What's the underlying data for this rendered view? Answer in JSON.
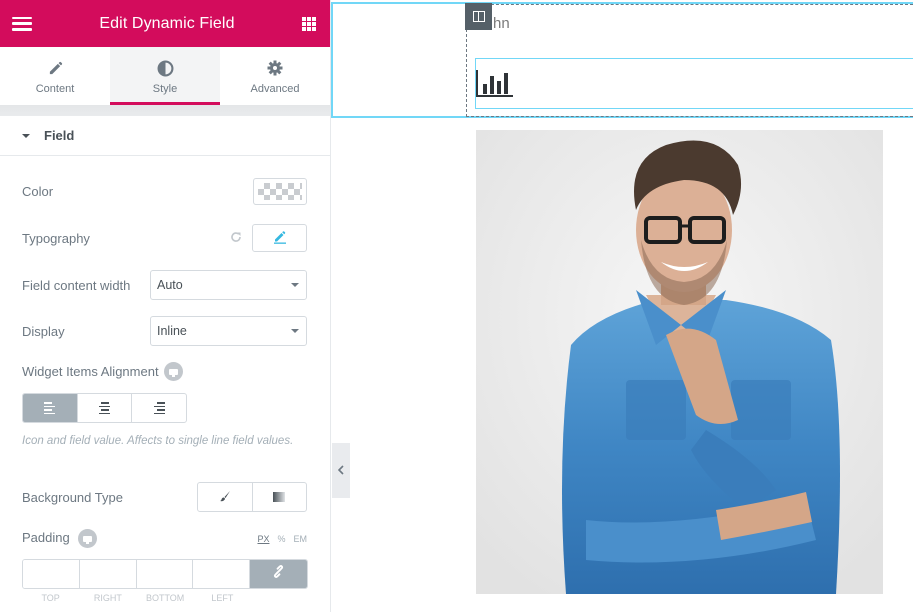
{
  "panel": {
    "header": {
      "title": "Edit Dynamic Field",
      "menu_icon": "hamburger-icon",
      "widgets_icon": "grid-icon",
      "brand_color": "#d30c5c"
    },
    "tabs": [
      {
        "label": "Content",
        "icon": "pencil-icon",
        "active": false
      },
      {
        "label": "Style",
        "icon": "contrast-icon",
        "active": true
      },
      {
        "label": "Advanced",
        "icon": "gear-icon",
        "active": false
      }
    ],
    "section": {
      "title": "Field",
      "expanded": true
    },
    "controls": {
      "color": {
        "label": "Color",
        "value": ""
      },
      "typography": {
        "label": "Typography",
        "reset_icon": "reset-icon",
        "edit_icon": "pencil-icon"
      },
      "content_width": {
        "label": "Field content width",
        "value": "Auto"
      },
      "display": {
        "label": "Display",
        "value": "Inline"
      },
      "alignment": {
        "label": "Widget Items Alignment",
        "responsive_icon": "desktop-icon",
        "options": [
          {
            "name": "left",
            "icon": "align-left-icon",
            "active": true
          },
          {
            "name": "center",
            "icon": "align-center-icon",
            "active": false
          },
          {
            "name": "right",
            "icon": "align-right-icon",
            "active": false
          }
        ],
        "description": "Icon and field value. Affects to single line field values."
      },
      "background_type": {
        "label": "Background Type",
        "options": [
          {
            "name": "classic",
            "icon": "brush-icon"
          },
          {
            "name": "gradient",
            "icon": "gradient-icon"
          }
        ]
      },
      "padding": {
        "label": "Padding",
        "responsive_icon": "desktop-icon",
        "units": [
          "PX",
          "%",
          "EM"
        ],
        "selected_unit": "PX",
        "fields": [
          {
            "label": "TOP",
            "value": ""
          },
          {
            "label": "RIGHT",
            "value": ""
          },
          {
            "label": "BOTTOM",
            "value": ""
          },
          {
            "label": "LEFT",
            "value": ""
          }
        ],
        "link_icon": "link-icon"
      }
    },
    "collapse_icon": "chevron-left-icon"
  },
  "preview": {
    "name_text": "hn",
    "column_handle_icon": "columns-icon",
    "widget_icon": "bar-chart-icon",
    "photo_alt": "Smiling man with glasses in denim shirt"
  }
}
